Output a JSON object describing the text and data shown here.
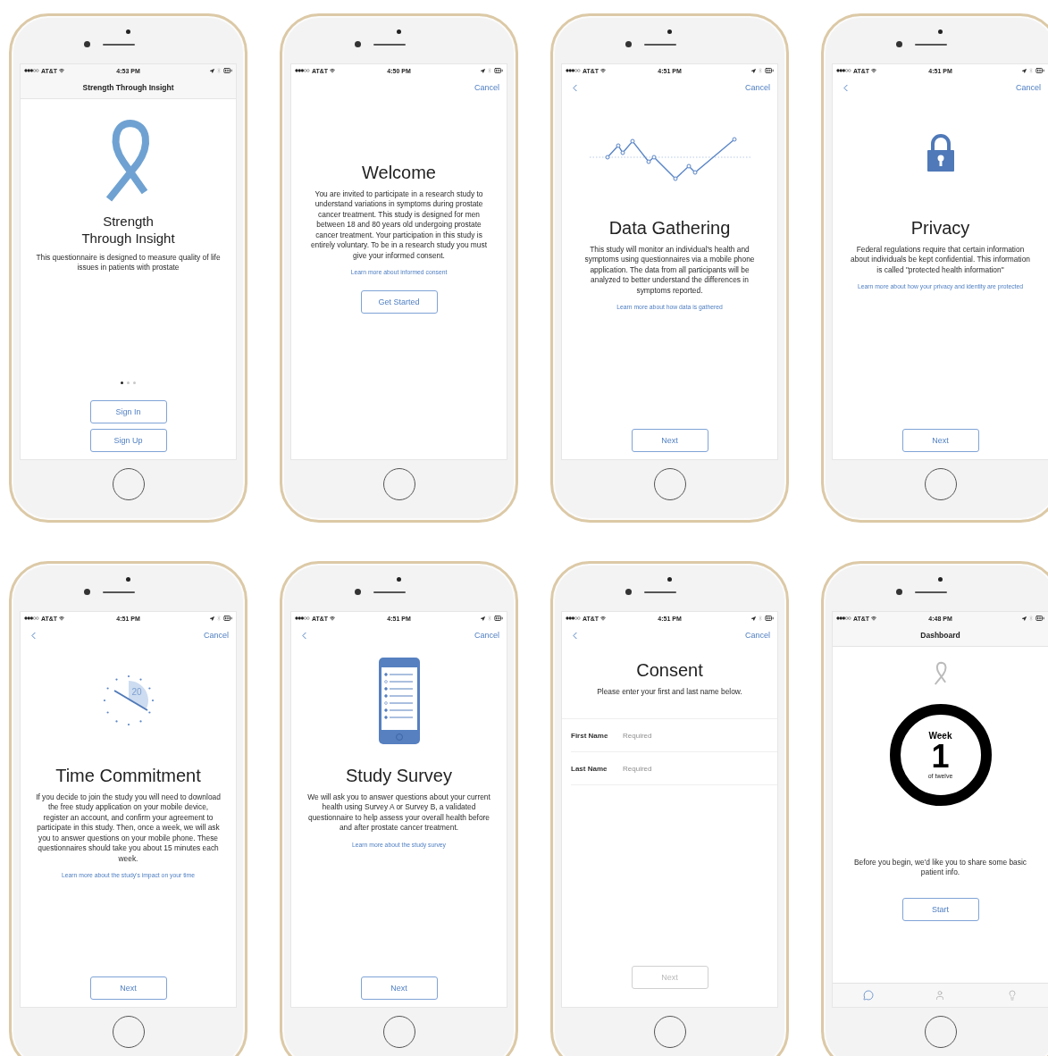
{
  "screens": [
    {
      "kind": "intro",
      "status": {
        "carrier": "AT&T",
        "time": "4:53 PM"
      },
      "nav": {
        "back": false,
        "title": "Strength Through Insight"
      },
      "illustration": {
        "kind": "ribbon"
      },
      "heading": "Strength Through Insight",
      "body": "This questionnaire is designed to measure quality of life issues in patients with prostate",
      "page_dots": [
        {
          "selected": true
        },
        {
          "selected": false
        },
        {
          "selected": false
        }
      ],
      "buttons": [
        {
          "label": "Sign In",
          "disabled": false
        },
        {
          "label": "Sign Up",
          "disabled": false
        }
      ]
    },
    {
      "kind": "welcome",
      "status": {
        "carrier": "AT&T",
        "time": "4:50 PM"
      },
      "nav": {
        "back": false,
        "cancel": "Cancel"
      },
      "heading": "Welcome",
      "body": "You are invited to participate in a research study to understand variations in symptoms during prostate cancer treatment. This study is designed for men between 18 and 80 years old undergoing prostate cancer treatment. Your participation in this study is entirely voluntary. To be in a research study you must give your informed consent.",
      "link": "Learn more about informed consent",
      "buttons": [
        {
          "label": "Get Started",
          "disabled": false
        }
      ]
    },
    {
      "kind": "step",
      "status": {
        "carrier": "AT&T",
        "time": "4:51 PM"
      },
      "nav": {
        "back": true,
        "cancel": "Cancel"
      },
      "illustration": {
        "kind": "wave"
      },
      "heading": "Data Gathering",
      "body": "This study will monitor an individual's health and symptoms using questionnaires via a mobile phone application. The data from all participants will be analyzed to better understand the differences in symptoms reported.",
      "link": "Learn more about how data is gathered",
      "buttons": [
        {
          "label": "Next",
          "disabled": false
        }
      ]
    },
    {
      "kind": "step",
      "status": {
        "carrier": "AT&T",
        "time": "4:51 PM"
      },
      "nav": {
        "back": true,
        "cancel": "Cancel"
      },
      "illustration": {
        "kind": "lock"
      },
      "heading": "Privacy",
      "body": "Federal regulations require that certain information about individuals be kept confidential. This information is called \"protected health information\"",
      "link": "Learn more about how your privacy and identity are protected",
      "buttons": [
        {
          "label": "Next",
          "disabled": false
        }
      ]
    },
    {
      "kind": "step",
      "status": {
        "carrier": "AT&T",
        "time": "4:51 PM"
      },
      "nav": {
        "back": true,
        "cancel": "Cancel"
      },
      "illustration": {
        "kind": "clock",
        "label": "20"
      },
      "heading": "Time Commitment",
      "body": "If you decide to join the study you will need to download the free study application on your mobile device, register an account, and confirm your agreement to participate in this study. Then, once a week, we will ask you to answer questions on your mobile phone. These questionnaires should take you about 15 minutes each week.",
      "link": "Learn more about the study's impact on your time",
      "buttons": [
        {
          "label": "Next",
          "disabled": false
        }
      ]
    },
    {
      "kind": "step",
      "status": {
        "carrier": "AT&T",
        "time": "4:51 PM"
      },
      "nav": {
        "back": true,
        "cancel": "Cancel"
      },
      "illustration": {
        "kind": "phone"
      },
      "heading": "Study Survey",
      "body": "We will ask you to answer questions about your current health using Survey A or Survey B, a validated questionnaire to help assess your overall health before and after prostate cancer treatment.",
      "link": "Learn more about the study survey",
      "buttons": [
        {
          "label": "Next",
          "disabled": false
        }
      ]
    },
    {
      "kind": "consent",
      "status": {
        "carrier": "AT&T",
        "time": "4:51 PM"
      },
      "nav": {
        "back": true,
        "cancel": "Cancel"
      },
      "heading": "Consent",
      "body": "Please enter your first and last name below.",
      "fields": [
        {
          "label": "First Name",
          "placeholder": "Required"
        },
        {
          "label": "Last Name",
          "placeholder": "Required"
        }
      ],
      "buttons": [
        {
          "label": "Next",
          "disabled": true
        }
      ]
    },
    {
      "kind": "dashboard",
      "status": {
        "carrier": "AT&T",
        "time": "4:48 PM"
      },
      "nav": {
        "back": false,
        "title": "Dashboard"
      },
      "illustration": {
        "kind": "small-ribbon"
      },
      "week": {
        "label": "Week",
        "number": "1",
        "sub": "of twelve"
      },
      "body": "Before you begin, we'd like you to share some basic patient info.",
      "buttons": [
        {
          "label": "Start",
          "disabled": false
        }
      ],
      "tabs": [
        {
          "selected": true
        },
        {
          "selected": false
        },
        {
          "selected": false
        }
      ]
    }
  ]
}
